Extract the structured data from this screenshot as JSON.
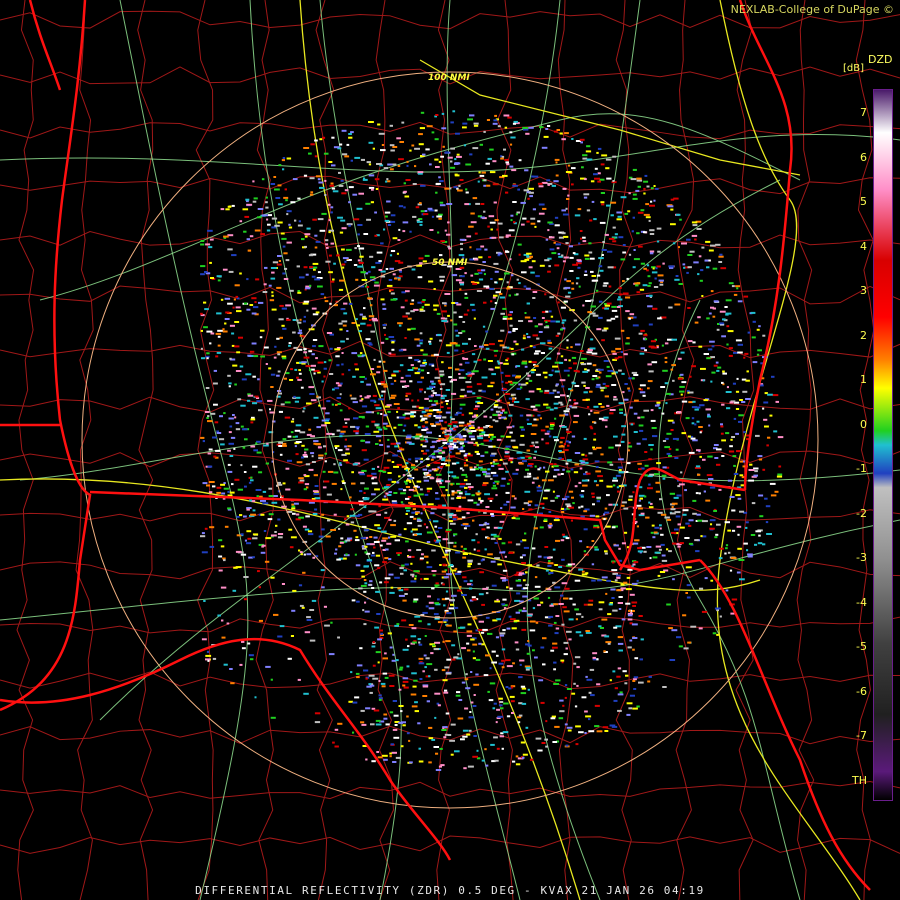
{
  "product_label": "DZD",
  "unit_label": "[dB]",
  "credit": "NEXLAB-College of DuPage ©",
  "footer": "DIFFERENTIAL REFLECTIVITY (ZDR) 0.5 DEG - KVAX 21 JAN 26 04:19",
  "rings": {
    "inner": "50 NMI",
    "outer": "100 NMI"
  },
  "color_scale": {
    "ticks": [
      "7",
      "6",
      "5",
      "4",
      "3",
      "2",
      "1",
      "0",
      "-1",
      "-2",
      "-3",
      "-4",
      "-5",
      "-6",
      "-7",
      "TH"
    ],
    "colors": {
      "top": "#4a1a6a",
      "pink": "#ff8fc8",
      "red": "#d80000",
      "orange": "#ff8000",
      "yellow": "#ffff00",
      "green": "#20d020",
      "cyan": "#20c0d0",
      "blue": "#2040c0",
      "gray": "#c0c0c0",
      "dark": "#404040",
      "purple": "#5a1a7a"
    }
  },
  "map_colors": {
    "state_border": "#ff1010",
    "county": "#a01818",
    "highway": "#e8e820",
    "road": "#90e090",
    "range_ring": "#f0b080"
  }
}
